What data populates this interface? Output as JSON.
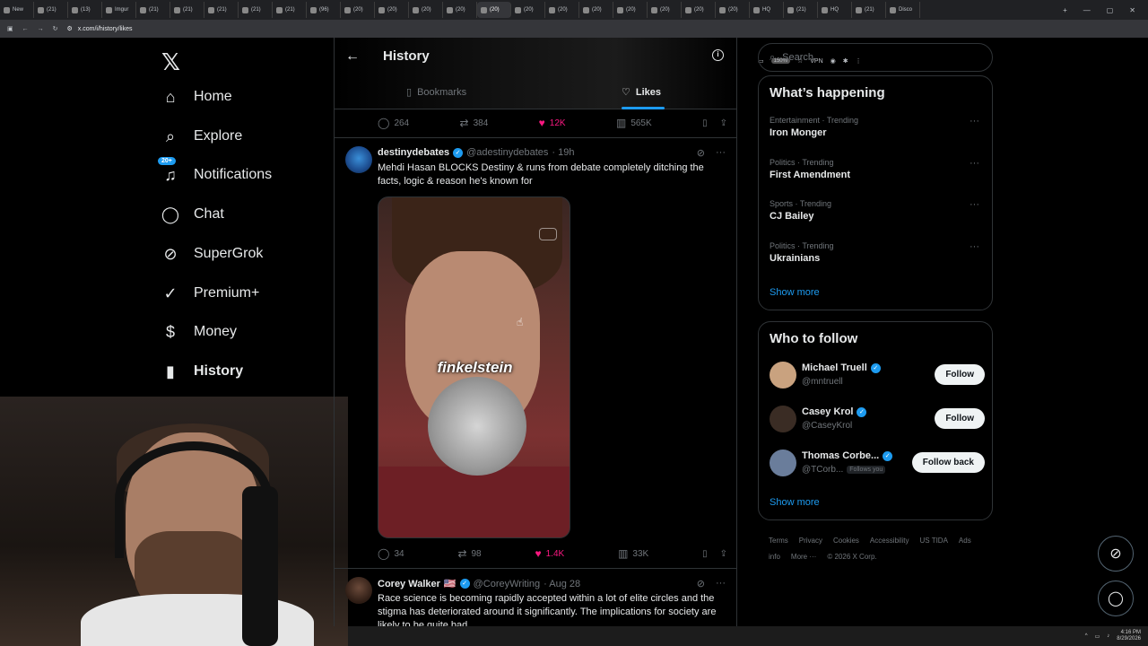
{
  "browser": {
    "tabs": [
      "New",
      "(21)",
      "(13)",
      "Imgur",
      "(21)",
      "(21)",
      "(21)",
      "(21)",
      "(21)",
      "(96)",
      "(20)",
      "(20)",
      "(20)",
      "(20)",
      "(20)",
      "(20)",
      "(20)",
      "(20)",
      "(20)",
      "(20)",
      "(20)",
      "(20)",
      "HQ",
      "(21)",
      "HQ",
      "(21)",
      "Disco"
    ],
    "active_tab": "(20)",
    "url": "x.com/i/history/likes",
    "zoom": "150%",
    "vpn": "VPN"
  },
  "sidebar": {
    "items": [
      {
        "label": "Home",
        "icon": "home-icon",
        "glyph": "⌂"
      },
      {
        "label": "Explore",
        "icon": "search-icon",
        "glyph": "⌕"
      },
      {
        "label": "Notifications",
        "icon": "bell-icon",
        "glyph": "♫",
        "badge": "20+"
      },
      {
        "label": "Chat",
        "icon": "chat-icon",
        "glyph": "◯"
      },
      {
        "label": "SuperGrok",
        "icon": "grok-icon",
        "glyph": "⊘"
      },
      {
        "label": "Premium+",
        "icon": "verified-icon",
        "glyph": "✓"
      },
      {
        "label": "Money",
        "icon": "dollar-icon",
        "glyph": "$"
      },
      {
        "label": "History",
        "icon": "bookmark-icon",
        "glyph": "▮"
      }
    ]
  },
  "header": {
    "title": "History",
    "tabs": {
      "bookmarks": "Bookmarks",
      "likes": "Likes"
    }
  },
  "prev_tweet_actions": {
    "replies": "264",
    "reposts": "384",
    "likes": "12K",
    "views": "565K"
  },
  "tweets": [
    {
      "name": "destinydebates",
      "handle": "@adestinydebates",
      "time": "· 19h",
      "text": "Mehdi Hasan BLOCKS Destiny & runs from debate completely ditching the facts, logic & reason he's known for",
      "caption": "finkelstein",
      "replies": "34",
      "reposts": "98",
      "likes": "1.4K",
      "views": "33K"
    },
    {
      "name": "Corey Walker",
      "flag": "🇺🇸",
      "handle": "@CoreyWriting",
      "time": "· Aug 28",
      "text": "Race science is becoming rapidly accepted within a lot of elite circles and the stigma has deteriorated around it significantly. The implications for society are likely to be quite bad."
    }
  ],
  "search": {
    "placeholder": "Search"
  },
  "whats_happening": {
    "title": "What’s happening",
    "trends": [
      {
        "context": "Entertainment · Trending",
        "topic": "Iron Monger"
      },
      {
        "context": "Politics · Trending",
        "topic": "First Amendment"
      },
      {
        "context": "Sports · Trending",
        "topic": "CJ Bailey"
      },
      {
        "context": "Politics · Trending",
        "topic": "Ukrainians"
      }
    ],
    "show_more": "Show more"
  },
  "who_to_follow": {
    "title": "Who to follow",
    "users": [
      {
        "name": "Michael Truell",
        "handle": "@mntruell",
        "button": "Follow"
      },
      {
        "name": "Casey Krol",
        "handle": "@CaseyKrol",
        "button": "Follow"
      },
      {
        "name": "Thomas Corbe...",
        "handle": "@TCorb...",
        "follows_you": "Follows you",
        "button": "Follow back"
      }
    ],
    "show_more": "Show more"
  },
  "footer": {
    "links": [
      "Terms",
      "Privacy",
      "Cookies",
      "Accessibility",
      "US TIDA",
      "Ads info",
      "More ···"
    ],
    "copyright": "© 2026 X Corp."
  },
  "taskbar": {
    "time": "4:16 PM",
    "date": "8/29/2026"
  },
  "colors": {
    "accent": "#1d9bf0",
    "like": "#f91880",
    "bg": "#000000",
    "border": "#2f3336"
  }
}
